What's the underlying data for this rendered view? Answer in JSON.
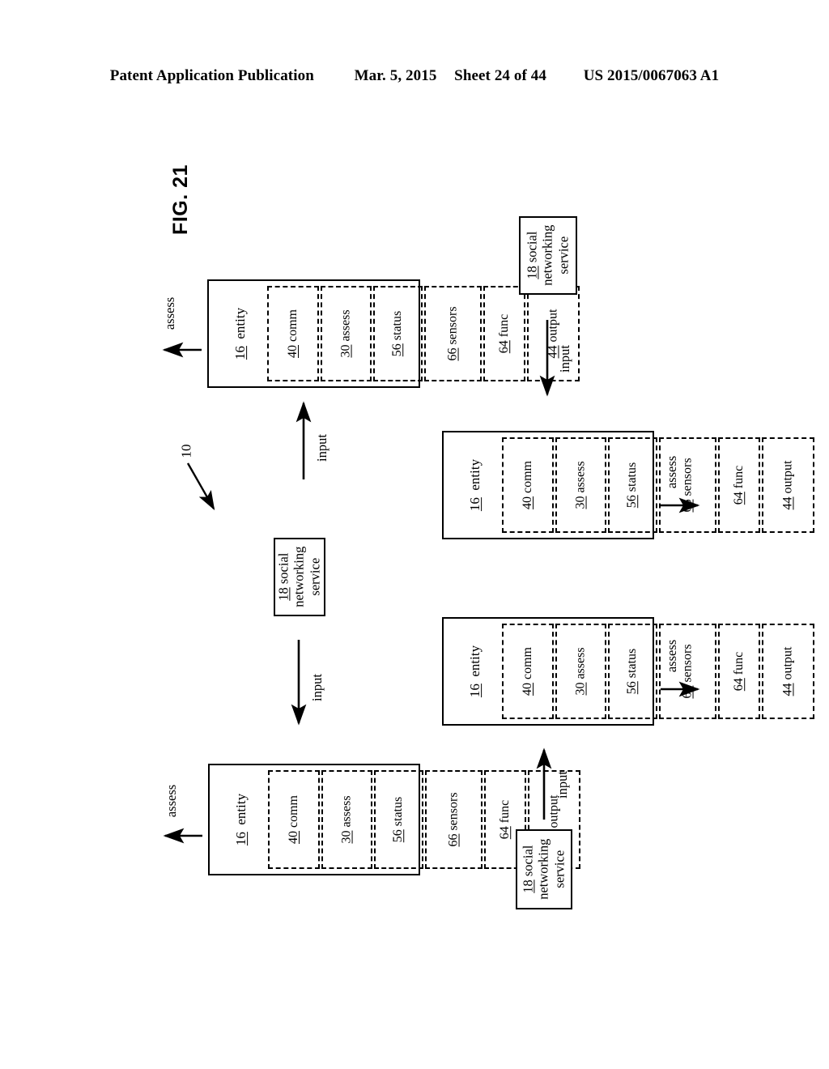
{
  "header": {
    "publication": "Patent Application Publication",
    "date": "Mar. 5, 2015",
    "sheet": "Sheet 24 of 44",
    "doc_number": "US 2015/0067063 A1"
  },
  "figure": {
    "label": "FIG. 21",
    "reference_numeral": "10"
  },
  "entity_block": {
    "title_num": "16",
    "title_text": "entity",
    "components": [
      {
        "num": "40",
        "label": "comm"
      },
      {
        "num": "30",
        "label": "assess"
      },
      {
        "num": "56",
        "label": "status"
      },
      {
        "num": "66",
        "label": "sensors"
      },
      {
        "num": "64",
        "label": "func"
      },
      {
        "num": "44",
        "label": "output"
      }
    ]
  },
  "sns_block": {
    "num": "18",
    "line1": "social",
    "line2": "networking",
    "line3": "service"
  },
  "entities": [
    {
      "id": "entity-top-left"
    },
    {
      "id": "entity-middle-right"
    },
    {
      "id": "entity-bottom-right"
    },
    {
      "id": "entity-bottom-left"
    }
  ],
  "services": [
    {
      "id": "sns-top-right"
    },
    {
      "id": "sns-middle-left"
    },
    {
      "id": "sns-bottom-right"
    }
  ],
  "arrows": [
    {
      "id": "assess-top-left",
      "label": "assess",
      "direction": "left"
    },
    {
      "id": "input-to-top-left",
      "label": "input",
      "direction": "up"
    },
    {
      "id": "input-to-mid-right",
      "label": "input",
      "direction": "down"
    },
    {
      "id": "assess-mid-right",
      "label": "assess",
      "direction": "right"
    },
    {
      "id": "input-to-bot-left",
      "label": "input",
      "direction": "down"
    },
    {
      "id": "assess-bot-left",
      "label": "assess",
      "direction": "left"
    },
    {
      "id": "input-to-bot-right",
      "label": "input",
      "direction": "up"
    },
    {
      "id": "assess-bot-right",
      "label": "assess",
      "direction": "right"
    }
  ],
  "colors": {
    "ink": "#000000",
    "paper": "#ffffff"
  }
}
